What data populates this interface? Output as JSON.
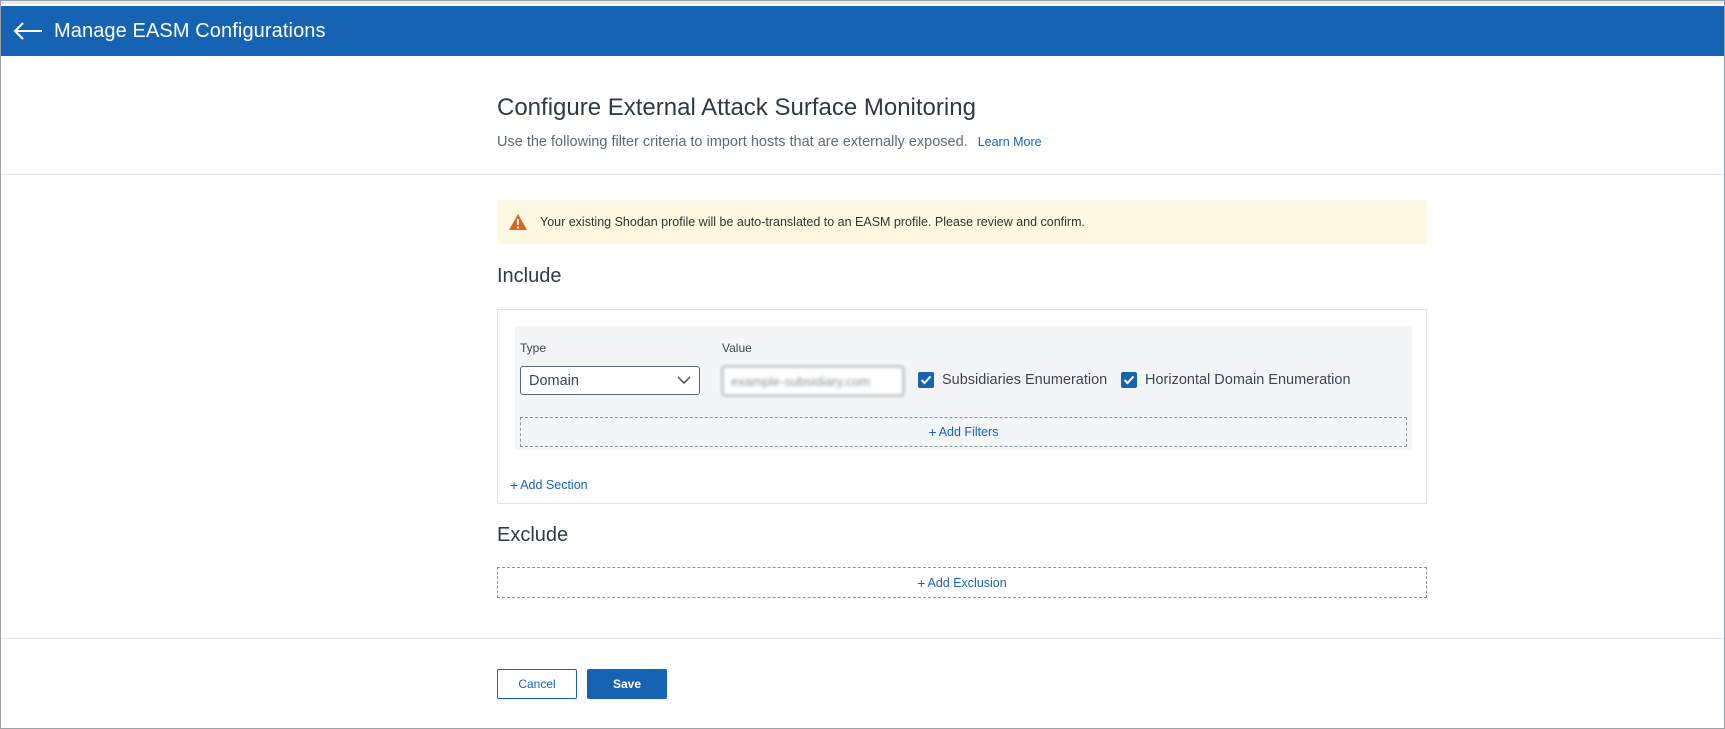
{
  "header": {
    "title": "Manage EASM Configurations"
  },
  "intro": {
    "title": "Configure External Attack Surface Monitoring",
    "subtitle": "Use the following filter criteria to import hosts that are externally exposed.",
    "learn_more": "Learn More"
  },
  "warning": {
    "text": "Your existing Shodan profile will be auto-translated to an EASM profile. Please review and confirm.",
    "color": "#fdf8e1",
    "icon_color": "#d9661f"
  },
  "include": {
    "heading": "Include",
    "type_label": "Type",
    "type_value": "Domain",
    "value_label": "Value",
    "value_placeholder": "",
    "value_text": "example-subsidiary.com",
    "checkboxes": [
      {
        "label": "Subsidiaries Enumeration",
        "checked": true
      },
      {
        "label": "Horizontal Domain Enumeration",
        "checked": true
      }
    ],
    "add_filters": "Add Filters",
    "add_section": "Add Section"
  },
  "exclude": {
    "heading": "Exclude",
    "add_exclusion": "Add Exclusion"
  },
  "footer": {
    "cancel": "Cancel",
    "save": "Save"
  },
  "colors": {
    "accent": "#1763b3",
    "header_bg": "#1763b3"
  }
}
